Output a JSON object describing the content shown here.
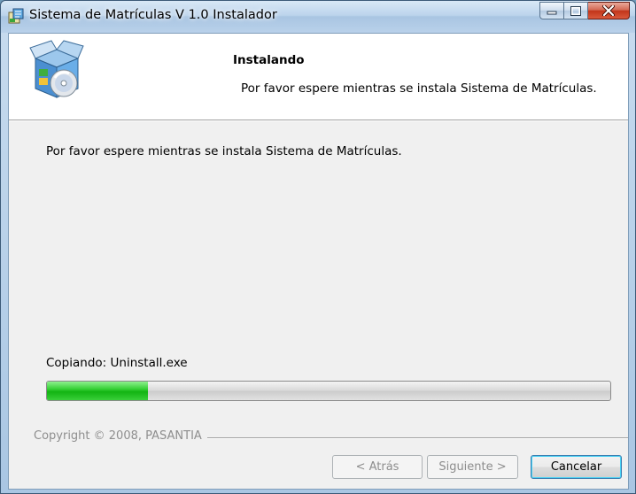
{
  "window": {
    "title": "Sistema de Matrículas V 1.0 Instalador",
    "controls": {
      "minimize": "minimize",
      "maximize": "maximize",
      "close": "close"
    }
  },
  "banner": {
    "title": "Instalando",
    "subtitle": "Por favor espere mientras se instala Sistema de Matrículas.",
    "icon": "installer-box-cd-icon"
  },
  "main": {
    "description": "Por favor espere mientras se instala Sistema de Matrículas.",
    "status": "Copiando: Uninstall.exe",
    "progress_fraction": 0.18
  },
  "footer": {
    "copyright": "Copyright © 2008, PASANTIA",
    "buttons": {
      "back": "< Atrás",
      "next": "Siguiente >",
      "cancel": "Cancelar"
    }
  },
  "colors": {
    "progress": "#12b412",
    "close_button": "#c2351b"
  }
}
